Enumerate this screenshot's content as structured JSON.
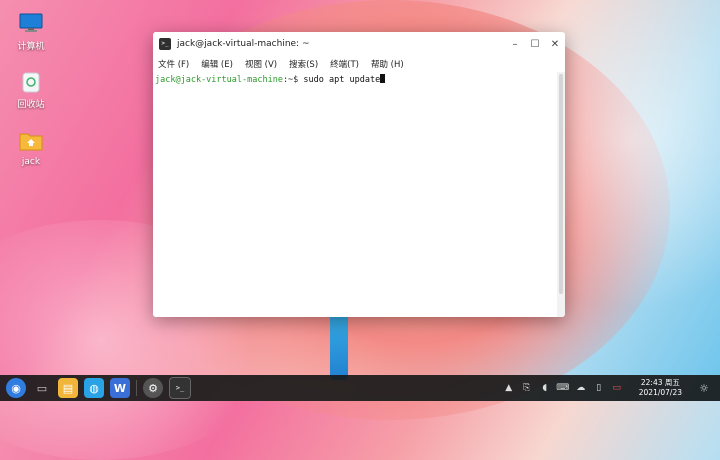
{
  "desktop": {
    "icons": [
      {
        "label": "计算机",
        "icon": "computer-icon"
      },
      {
        "label": "回收站",
        "icon": "trash-icon"
      },
      {
        "label": "jack",
        "icon": "home-folder-icon"
      }
    ]
  },
  "window": {
    "title": "jack@jack-virtual-machine: ~",
    "menu": [
      "文件 (F)",
      "编辑 (E)",
      "视图 (V)",
      "搜索(S)",
      "终端(T)",
      "帮助 (H)"
    ],
    "terminal": {
      "user_host": "jack@jack-virtual-machine",
      "path": ":~$ ",
      "command": "sudo apt update"
    }
  },
  "taskbar": {
    "clock_time": "22:43 周五",
    "clock_date": "2021/07/23"
  },
  "colors": {
    "taskbar_bg": "#191919",
    "prompt_green": "#2c9a2c"
  }
}
